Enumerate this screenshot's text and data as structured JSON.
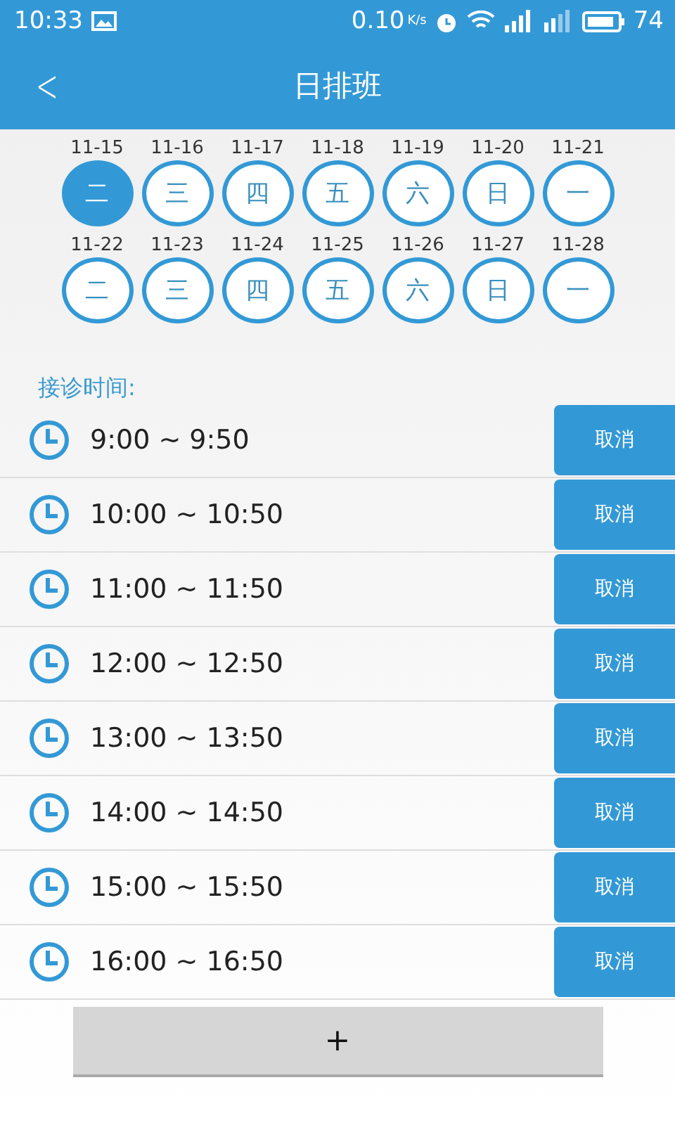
{
  "status_bar": {
    "time": "10:33",
    "speed": "0.10",
    "speed_unit": "K/s",
    "battery": "74"
  },
  "header": {
    "back": "<",
    "title": "日排班"
  },
  "days": [
    {
      "date": "11-15",
      "weekday": "二",
      "selected": true
    },
    {
      "date": "11-16",
      "weekday": "三",
      "selected": false
    },
    {
      "date": "11-17",
      "weekday": "四",
      "selected": false
    },
    {
      "date": "11-18",
      "weekday": "五",
      "selected": false
    },
    {
      "date": "11-19",
      "weekday": "六",
      "selected": false
    },
    {
      "date": "11-20",
      "weekday": "日",
      "selected": false
    },
    {
      "date": "11-21",
      "weekday": "一",
      "selected": false
    },
    {
      "date": "11-22",
      "weekday": "二",
      "selected": false
    },
    {
      "date": "11-23",
      "weekday": "三",
      "selected": false
    },
    {
      "date": "11-24",
      "weekday": "四",
      "selected": false
    },
    {
      "date": "11-25",
      "weekday": "五",
      "selected": false
    },
    {
      "date": "11-26",
      "weekday": "六",
      "selected": false
    },
    {
      "date": "11-27",
      "weekday": "日",
      "selected": false
    },
    {
      "date": "11-28",
      "weekday": "一",
      "selected": false
    }
  ],
  "section_label": "接诊时间:",
  "slots": [
    {
      "time": "9:00 ~ 9:50",
      "action": "取消"
    },
    {
      "time": "10:00 ~ 10:50",
      "action": "取消"
    },
    {
      "time": "11:00 ~ 11:50",
      "action": "取消"
    },
    {
      "time": "12:00 ~ 12:50",
      "action": "取消"
    },
    {
      "time": "13:00 ~ 13:50",
      "action": "取消"
    },
    {
      "time": "14:00 ~ 14:50",
      "action": "取消"
    },
    {
      "time": "15:00 ~ 15:50",
      "action": "取消"
    },
    {
      "time": "16:00 ~ 16:50",
      "action": "取消"
    }
  ],
  "add_button": "+"
}
